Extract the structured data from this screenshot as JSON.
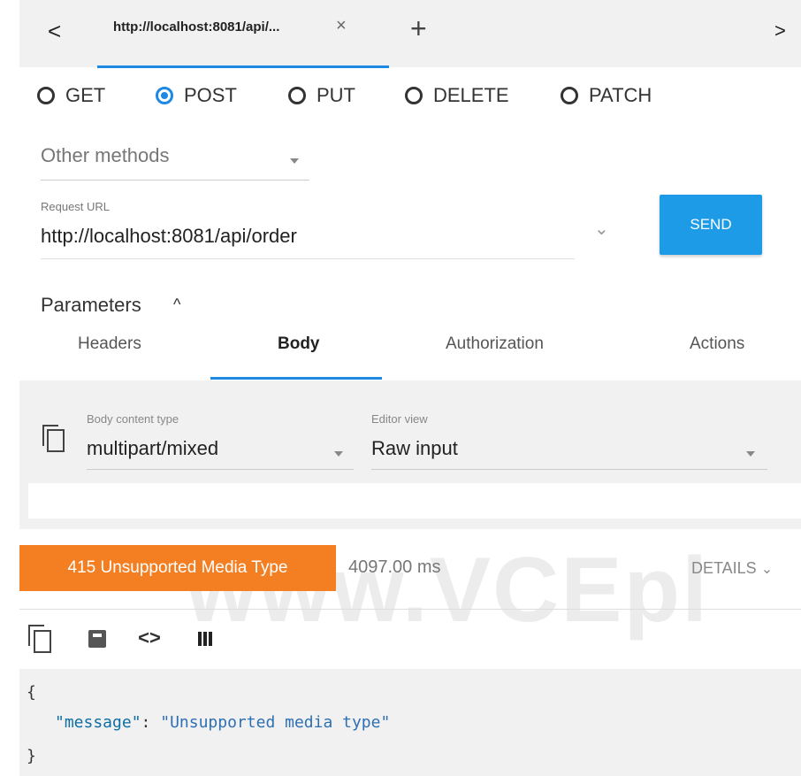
{
  "tabbar": {
    "back_glyph": "<",
    "tab_title": "http://localhost:8081/api/...",
    "tab_close": "×",
    "add_glyph": "+",
    "forward_glyph": ">"
  },
  "methods": [
    {
      "label": "GET",
      "selected": false
    },
    {
      "label": "POST",
      "selected": true
    },
    {
      "label": "PUT",
      "selected": false
    },
    {
      "label": "DELETE",
      "selected": false
    },
    {
      "label": "PATCH",
      "selected": false
    }
  ],
  "other_methods": "Other methods",
  "request": {
    "url_label": "Request URL",
    "url": "http://localhost:8081/api/order",
    "send_label": "SEND"
  },
  "parameters_label": "Parameters",
  "param_tabs": [
    "Headers",
    "Body",
    "Authorization",
    "Actions"
  ],
  "body": {
    "content_type_label": "Body content type",
    "content_type": "multipart/mixed",
    "editor_label": "Editor view",
    "editor_value": "Raw input"
  },
  "response": {
    "status": "415 Unsupported Media Type",
    "time": "4097.00 ms",
    "details_label": "DETAILS",
    "code_open": "{",
    "message_key": "\"message\"",
    "message_value": "\"Unsupported media type\"",
    "code_close": "}"
  },
  "watermark": "www.VCEpl",
  "colors": {
    "accent": "#1e88e5",
    "send_button": "#1e9be6",
    "status_error": "#f47f22"
  }
}
